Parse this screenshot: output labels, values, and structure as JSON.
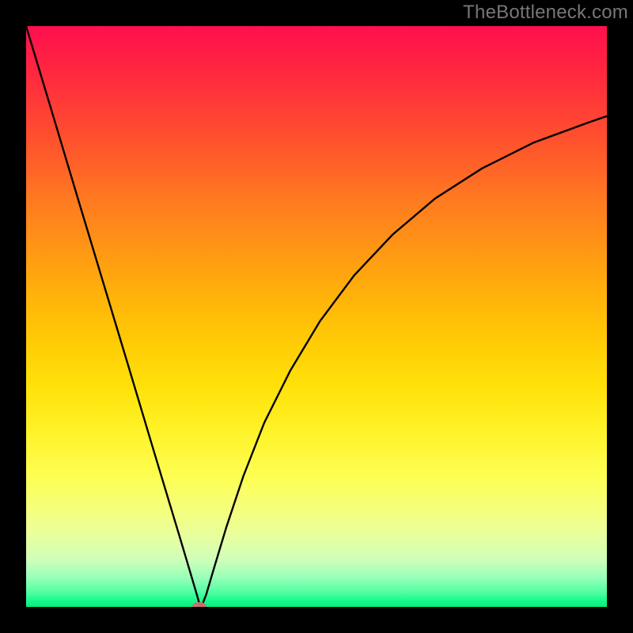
{
  "watermark": "TheBottleneck.com",
  "chart_data": {
    "type": "line",
    "title": "",
    "xlabel": "",
    "ylabel": "",
    "xlim": [
      0,
      1
    ],
    "ylim": [
      0,
      1
    ],
    "series": [
      {
        "name": "curve",
        "x": [
          0.0,
          0.044,
          0.088,
          0.132,
          0.176,
          0.22,
          0.264,
          0.281,
          0.294,
          0.299,
          0.303,
          0.31,
          0.323,
          0.345,
          0.374,
          0.41,
          0.455,
          0.506,
          0.565,
          0.631,
          0.704,
          0.785,
          0.873,
          0.968,
          1.0
        ],
        "y": [
          1.0,
          0.854,
          0.707,
          0.561,
          0.415,
          0.268,
          0.122,
          0.065,
          0.021,
          0.003,
          0.003,
          0.021,
          0.065,
          0.138,
          0.225,
          0.317,
          0.407,
          0.492,
          0.571,
          0.641,
          0.703,
          0.755,
          0.799,
          0.834,
          0.845
        ]
      }
    ],
    "marker": {
      "x": 0.298,
      "y": 0.001
    }
  },
  "colors": {
    "curve": "#000000",
    "marker": "#cf6f6b",
    "frame": "#000000"
  }
}
